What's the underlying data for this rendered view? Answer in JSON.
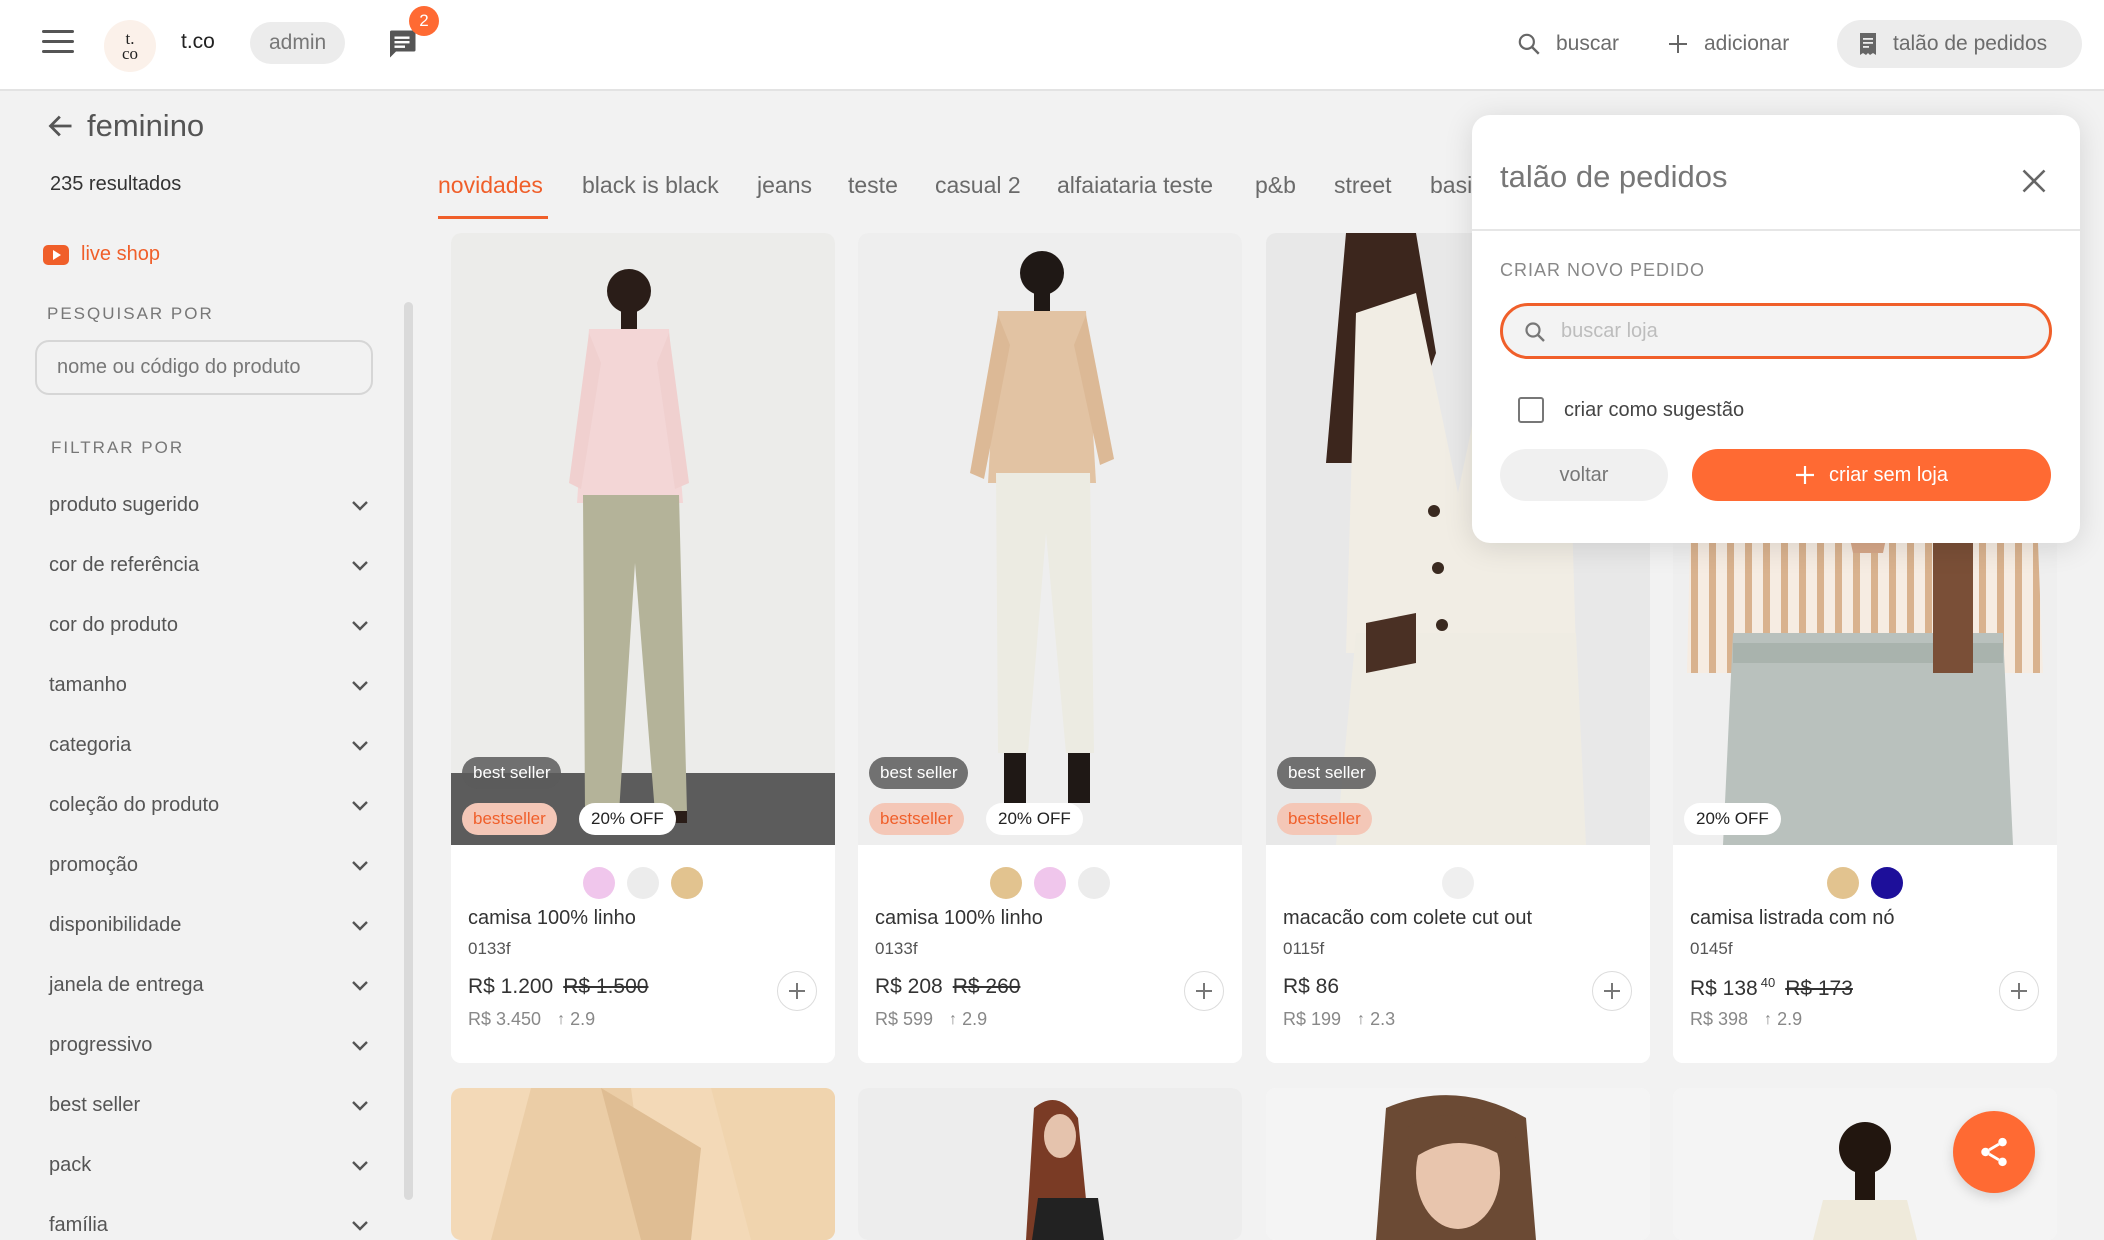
{
  "header": {
    "brand_logo_text": "t. co",
    "brand_name": "t.co",
    "role": "admin",
    "chat_badge_count": "2",
    "search_label": "buscar",
    "add_label": "adicionar",
    "orders_label": "talão de pedidos"
  },
  "page": {
    "title": "feminino",
    "results": "235 resultados"
  },
  "sidebar": {
    "live_shop_label": "live shop",
    "search_section": "PESQUISAR POR",
    "search_placeholder": "nome ou código do produto",
    "filter_section": "FILTRAR POR",
    "filters": [
      "produto sugerido",
      "cor de referência",
      "cor do produto",
      "tamanho",
      "categoria",
      "coleção do produto",
      "promoção",
      "disponibilidade",
      "janela de entrega",
      "progressivo",
      "best seller",
      "pack",
      "família"
    ]
  },
  "tabs": [
    "novidades",
    "black is black",
    "jeans",
    "teste",
    "casual 2",
    "alfaiataria teste",
    "p&b",
    "street",
    "basi"
  ],
  "active_tab": "novidades",
  "products": [
    {
      "name": "camisa 100% linho",
      "code": "0133f",
      "price": "R$ 1.200",
      "old_price": "R$ 1.500",
      "price_sup": "",
      "retail": "R$ 3.450",
      "markup": "2.9",
      "badge_best": "best seller",
      "badge_tag": "bestseller",
      "badge_off": "20% OFF",
      "swatches": [
        "#f0c6ec",
        "#ececec",
        "#e2c38f"
      ]
    },
    {
      "name": "camisa 100% linho",
      "code": "0133f",
      "price": "R$ 208",
      "old_price": "R$ 260",
      "price_sup": "",
      "retail": "R$ 599",
      "markup": "2.9",
      "badge_best": "best seller",
      "badge_tag": "bestseller",
      "badge_off": "20% OFF",
      "swatches": [
        "#e2c38f",
        "#f0c6ec",
        "#ececec"
      ]
    },
    {
      "name": "macacão com colete cut out",
      "code": "0115f",
      "price": "R$ 86",
      "old_price": "",
      "price_sup": "",
      "retail": "R$ 199",
      "markup": "2.3",
      "badge_best": "best seller",
      "badge_tag": "bestseller",
      "badge_off": "",
      "swatches": [
        "#efefef"
      ]
    },
    {
      "name": "camisa listrada com nó",
      "code": "0145f",
      "price": "R$ 138",
      "old_price": "R$ 173",
      "price_sup": "40",
      "retail": "R$ 398",
      "markup": "2.9",
      "badge_best": "",
      "badge_tag": "",
      "badge_off": "20% OFF",
      "swatches": [
        "#e2c38f",
        "#1d0f9a"
      ]
    }
  ],
  "modal": {
    "title": "talão de pedidos",
    "section": "CRIAR NOVO PEDIDO",
    "store_placeholder": "buscar loja",
    "checkbox_label": "criar como sugestão",
    "back_label": "voltar",
    "create_label": "criar sem loja"
  },
  "colors": {
    "accent": "#ff6a33",
    "accent_text": "#f05f2a"
  }
}
